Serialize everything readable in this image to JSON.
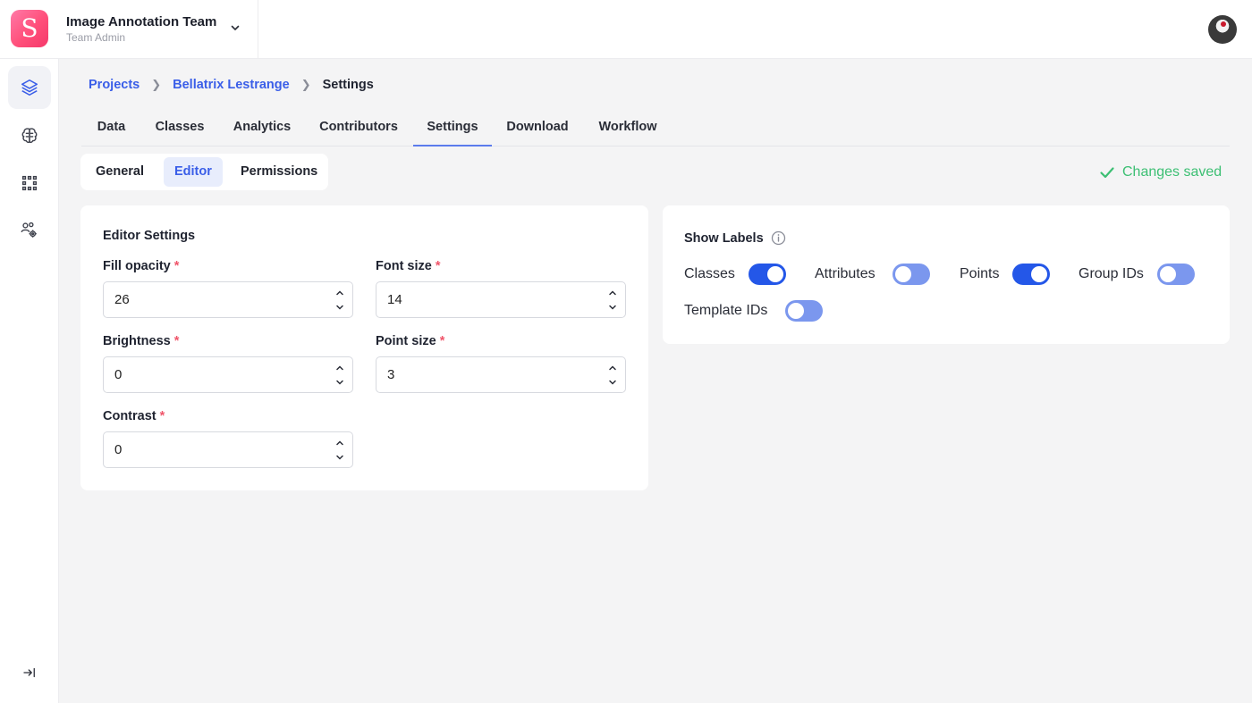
{
  "header": {
    "logo_letter": "S",
    "team_name": "Image Annotation Team",
    "team_role": "Team Admin"
  },
  "breadcrumb": {
    "items": [
      "Projects",
      "Bellatrix Lestrange",
      "Settings"
    ]
  },
  "tabs": [
    {
      "label": "Data"
    },
    {
      "label": "Classes"
    },
    {
      "label": "Analytics"
    },
    {
      "label": "Contributors"
    },
    {
      "label": "Settings",
      "active": true
    },
    {
      "label": "Download"
    },
    {
      "label": "Workflow"
    }
  ],
  "subtabs": [
    {
      "label": "General"
    },
    {
      "label": "Editor",
      "active": true
    },
    {
      "label": "Permissions"
    }
  ],
  "status": {
    "saved_text": "Changes saved",
    "color": "#3cbf73"
  },
  "editor_settings": {
    "title": "Editor Settings",
    "fields": [
      {
        "label": "Fill opacity",
        "value": "26",
        "required_mark": "*"
      },
      {
        "label": "Font size",
        "value": "14",
        "required_mark": "*"
      },
      {
        "label": "Brightness",
        "value": "0",
        "required_mark": "*"
      },
      {
        "label": "Point size",
        "value": "3",
        "required_mark": "*"
      },
      {
        "label": "Contrast",
        "value": "0",
        "required_mark": "*"
      }
    ]
  },
  "show_labels": {
    "title": "Show Labels",
    "toggles": [
      {
        "label": "Classes",
        "on": true
      },
      {
        "label": "Attributes",
        "on": false
      },
      {
        "label": "Points",
        "on": true
      },
      {
        "label": "Group IDs",
        "on": false
      },
      {
        "label": "Template IDs",
        "on": false
      }
    ]
  },
  "sidebar": {
    "icons": [
      "layers-icon",
      "brain-icon",
      "grid-icon",
      "users-settings-icon",
      "collapse-sidebar-icon"
    ]
  },
  "colors": {
    "accent": "#3a5ee8",
    "toggle_on": "#2457e8",
    "toggle_off": "#7b97ee",
    "required": "#f0566b"
  }
}
